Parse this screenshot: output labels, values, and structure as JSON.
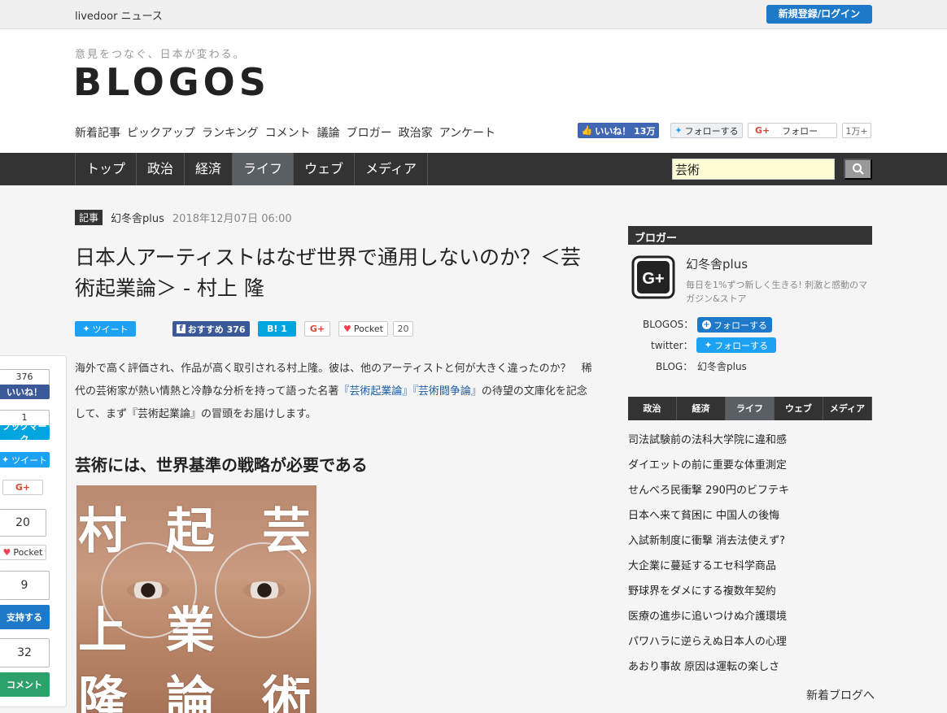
{
  "topbar": {
    "brand": "livedoor ニュース",
    "login_label": "新規登録/ログイン"
  },
  "header": {
    "tagline": "意見をつなぐ、日本が変わる。",
    "logo": "BLOGOS",
    "subnav": [
      "新着記事",
      "ピックアップ",
      "ランキング",
      "コメント",
      "議論",
      "ブロガー",
      "政治家",
      "アンケート"
    ],
    "social": {
      "fb_like": "いいね！ 13万",
      "tw_follow": "フォローする",
      "gp_follow": "フォロー",
      "gp_count": "1万+"
    }
  },
  "mainnav": {
    "items": [
      "トップ",
      "政治",
      "経済",
      "ライフ",
      "ウェブ",
      "メディア"
    ],
    "active": "ライフ"
  },
  "search": {
    "value": "芸術"
  },
  "article": {
    "tag": "記事",
    "author": "幻冬舎plus",
    "date": "2018年12月07日 06:00",
    "title": "日本人アーティストはなぜ世界で通用しないのか？＜芸術起業論＞ - 村上 隆",
    "share": {
      "tweet": "ツイート",
      "fb": "おすすめ 376",
      "hatena": "B! 1",
      "gplus": "G+",
      "pocket": "Pocket",
      "pocket_count": "20"
    },
    "lead_1": "海外で高く評価され、作品が高く取引される村上隆。彼は、他のアーティストと何が大きく違ったのか？　稀代の芸術家が熱い情熱と冷静な分析を持って語った名著",
    "lead_link1": "『芸術起業論』",
    "lead_link2": "『芸術闘争論』",
    "lead_2": "の待望の文庫化を記念して、まず『芸術起業論』の冒頭をお届けします。",
    "h2": "芸術には、世界基準の戦略が必要である",
    "cover_glyphs": [
      "村",
      "起",
      "芸",
      "上",
      "業",
      "隆",
      "論",
      "術"
    ]
  },
  "float_share": {
    "fb_count": "376",
    "fb_label": "いいね！",
    "hb_count": "1",
    "hb_label": "ブックマーク",
    "tw_label": "ツイート",
    "gp_label": "G+",
    "pocket_count": "20",
    "pocket_label": "Pocket",
    "support_count": "9",
    "support_label": "支持する",
    "comment_count": "32",
    "comment_label": "コメント"
  },
  "sidebar": {
    "title": "ブロガー",
    "name": "幻冬舎plus",
    "desc": "毎日を1%ずつ新しく生きる! 刺激と感動のマガジン&ストア",
    "blogos_label": "BLOGOS：",
    "blogos_btn": "フォローする",
    "twitter_label": "twitter：",
    "twitter_btn": "フォローする",
    "blog_label": "BLOG：",
    "blog_value": "幻冬舎plus",
    "tabs": [
      "政治",
      "経済",
      "ライフ",
      "ウェブ",
      "メディア"
    ],
    "active_tab": "ライフ",
    "list": [
      "司法試験前の法科大学院に違和感",
      "ダイエットの前に重要な体重測定",
      "せんべろ民衝撃 290円のビフテキ",
      "日本へ来て貧困に 中国人の後悔",
      "入試新制度に衝撃 消去法使えず?",
      "大企業に蔓延するエセ科学商品",
      "野球界をダメにする複数年契約",
      "医療の進歩に追いつけぬ介護環境",
      "パワハラに逆らえぬ日本人の心理",
      "あおり事故 原因は運転の楽しさ"
    ],
    "more": "新着ブログへ"
  },
  "colors": {
    "accent": "#1e7ac9",
    "nav_bg": "#333333",
    "facebook": "#3b5998",
    "twitter": "#1da1f2",
    "hatena": "#00a4de",
    "pocket": "#ef4056",
    "comment": "#2ea06b"
  }
}
